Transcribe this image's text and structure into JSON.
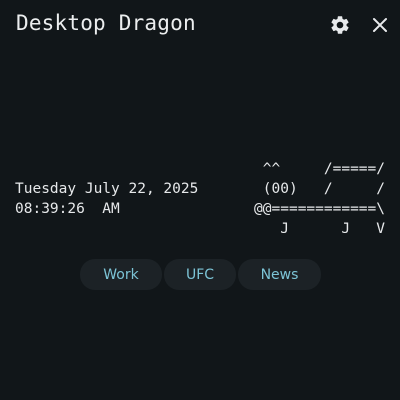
{
  "app": {
    "title": "Desktop Dragon",
    "settings_icon": "gear-icon",
    "close_icon": "close-icon"
  },
  "clock": {
    "date": "Tuesday July 22, 2025",
    "time": "08:39:26  AM"
  },
  "dragon_art": [
    "^^     /=====/",
    "(00)   /     /",
    "@@============\\",
    "J      J   V"
  ],
  "links": [
    {
      "label": "Work"
    },
    {
      "label": "UFC"
    },
    {
      "label": "News"
    }
  ],
  "colors": {
    "background": "#111619",
    "text": "#e8eaec",
    "link_text": "#7cc4d6",
    "link_background": "#1c2226"
  }
}
